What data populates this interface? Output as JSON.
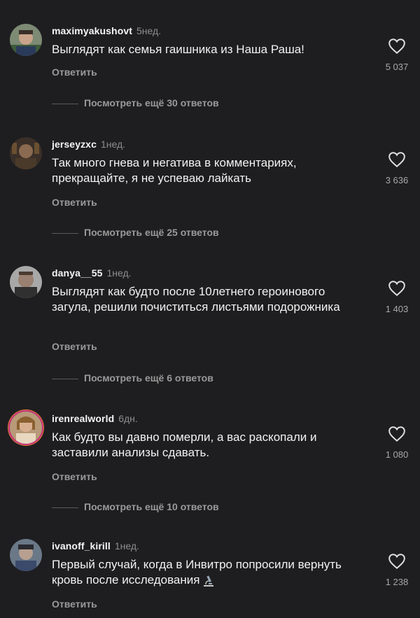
{
  "comments": [
    {
      "username": "maximyakushovt",
      "time": "5нед.",
      "text": "Выглядят как семья гаишника из Наша Раша!",
      "reply": "Ответить",
      "likes": "5 037",
      "more": "Посмотреть ещё 30 ответов"
    },
    {
      "username": "jerseyzxc",
      "time": "1нед.",
      "text": "Так много гнева и негатива в комментариях, прекращайте, я не успеваю лайкать",
      "reply": "Ответить",
      "likes": "3 636",
      "more": "Посмотреть ещё 25 ответов"
    },
    {
      "username": "danya__55",
      "time": "1нед.",
      "text": "Выглядят как будто после 10летнего героинового загула, решили почиститься листьями подорожника",
      "reply": "Ответить",
      "likes": "1 403",
      "more": "Посмотреть ещё 6 ответов"
    },
    {
      "username": "irenrealworld",
      "time": "6дн.",
      "text": "Как будто вы давно померли, а вас раскопали и заставили анализы сдавать.",
      "reply": "Ответить",
      "likes": "1 080",
      "more": "Посмотреть ещё 10 ответов"
    },
    {
      "username": "ivanoff_kirill",
      "time": "1нед.",
      "text": "Первый случай, когда в Инвитро попросили вернуть кровь после исследования",
      "reply": "Ответить",
      "likes": "1 238",
      "emoji": "microscope-icon"
    }
  ],
  "colors": {
    "background": "#1e1e20",
    "text": "#f2f2f2",
    "muted": "#9a9a9a",
    "story_ring": "#c5327f"
  }
}
